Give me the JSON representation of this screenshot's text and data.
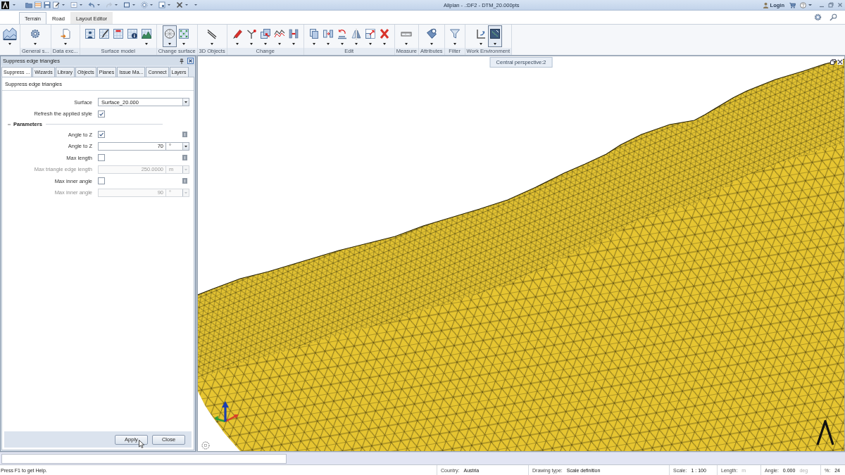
{
  "title_bar": {
    "title": "Allplan - .:DF2 - DTM_20.000pts",
    "login": "Login"
  },
  "ribbon": {
    "tabs": [
      {
        "label": "Terrain",
        "selected": true,
        "kind": "standard"
      },
      {
        "label": "Road",
        "selected": false,
        "kind": "standard"
      },
      {
        "label": "Layout Editor",
        "selected": false,
        "kind": "contextual"
      }
    ],
    "groups": [
      {
        "tools": [
          {
            "kind": "terrain",
            "selected": false,
            "dropdown": true
          }
        ]
      },
      {
        "label": "General s...",
        "tools": [
          {
            "kind": "gear",
            "selected": false,
            "dropdown": true
          }
        ]
      },
      {
        "label": "Data exc...",
        "tools": [
          {
            "kind": "document",
            "selected": false,
            "dropdown": true
          }
        ]
      },
      {
        "label": "Surface model",
        "tools": [
          {
            "kind": "surveyor",
            "selected": false,
            "dropdown": false
          },
          {
            "kind": "brush",
            "selected": false,
            "dropdown": false
          },
          {
            "kind": "marker",
            "selected": false,
            "dropdown": false
          },
          {
            "kind": "info",
            "selected": false,
            "dropdown": false
          },
          {
            "kind": "hills",
            "selected": false,
            "dropdown": true
          }
        ]
      },
      {
        "label": "Change surface",
        "tools": [
          {
            "kind": "mesh",
            "selected": true,
            "dropdown": true
          },
          {
            "kind": "points",
            "selected": false,
            "dropdown": true
          }
        ]
      },
      {
        "label": "3D Objects",
        "tools": [
          {
            "kind": "lines",
            "selected": false,
            "dropdown": true
          }
        ]
      },
      {
        "label": "Change",
        "tools": [
          {
            "kind": "pencil",
            "selected": false,
            "dropdown": true
          },
          {
            "kind": "branch",
            "selected": false,
            "dropdown": true
          },
          {
            "kind": "squares",
            "selected": false,
            "dropdown": true
          },
          {
            "kind": "polyline",
            "selected": false,
            "dropdown": true
          },
          {
            "kind": "beam",
            "selected": false,
            "dropdown": true
          }
        ]
      },
      {
        "label": "Edit",
        "tools": [
          {
            "kind": "copy",
            "selected": false,
            "dropdown": true
          },
          {
            "kind": "move",
            "selected": false,
            "dropdown": true
          },
          {
            "kind": "rotate",
            "selected": false,
            "dropdown": true
          },
          {
            "kind": "mirror",
            "selected": false,
            "dropdown": true
          },
          {
            "kind": "scale",
            "selected": false,
            "dropdown": true
          },
          {
            "kind": "delete",
            "selected": false,
            "dropdown": true
          }
        ]
      },
      {
        "label": "Measure",
        "tools": [
          {
            "kind": "ruler",
            "selected": false,
            "dropdown": true
          }
        ]
      },
      {
        "label": "Attributes",
        "tools": [
          {
            "kind": "tag",
            "selected": false,
            "dropdown": true
          }
        ]
      },
      {
        "label": "Filter",
        "tools": [
          {
            "kind": "funnel",
            "selected": false,
            "dropdown": true
          }
        ]
      },
      {
        "label": "Work Environment",
        "tools": [
          {
            "kind": "axes",
            "selected": false,
            "dropdown": true
          },
          {
            "kind": "screen",
            "selected": true,
            "dropdown": true
          }
        ]
      }
    ]
  },
  "panel": {
    "title": "Suppress edge triangles",
    "tabs": [
      {
        "label": "Suppress ...",
        "selected": true
      },
      {
        "label": "Wizards",
        "selected": false
      },
      {
        "label": "Library",
        "selected": false
      },
      {
        "label": "Objects",
        "selected": false
      },
      {
        "label": "Planes",
        "selected": false
      },
      {
        "label": "Issue Ma...",
        "selected": false
      },
      {
        "label": "Connect",
        "selected": false
      },
      {
        "label": "Layers",
        "selected": false
      }
    ],
    "heading": "Suppress edge triangles",
    "rows": [
      {
        "kind": "combo",
        "label": "Surface",
        "value": "Surface_20.000"
      },
      {
        "kind": "checkbox",
        "label": "Refresh the applied style",
        "checked": true,
        "info": false
      },
      {
        "kind": "section",
        "label": "Parameters",
        "expanded": true
      },
      {
        "kind": "checkbox",
        "label": "Angle to Z",
        "checked": true,
        "info": true
      },
      {
        "kind": "number",
        "label": "Angle to Z",
        "value": "70",
        "unit": "°",
        "disabled": false
      },
      {
        "kind": "checkbox",
        "label": "Max length",
        "checked": false,
        "info": true
      },
      {
        "kind": "number",
        "label": "Max triangle edge length",
        "value": "250.0000",
        "unit": "m",
        "disabled": true
      },
      {
        "kind": "checkbox",
        "label": "Max inner angle",
        "checked": false,
        "info": true
      },
      {
        "kind": "number",
        "label": "Max inner angle",
        "value": "90",
        "unit": "°",
        "disabled": true
      }
    ],
    "buttons": [
      {
        "label": "Apply"
      },
      {
        "label": "Close"
      }
    ]
  },
  "viewport": {
    "label": "Central perspective:2"
  },
  "status_bar": {
    "help": "Press F1 to get Help.",
    "fields": [
      {
        "label": "Country:",
        "value": "Austria"
      },
      {
        "label": "Drawing type:",
        "value": "Scale definition"
      },
      {
        "label": "Scale:",
        "value": "1 : 100"
      },
      {
        "label": "Length:",
        "unit": "m"
      },
      {
        "label": "Angle:",
        "value": "0.000",
        "unit": "deg"
      },
      {
        "label": "%:",
        "value": "24"
      }
    ]
  }
}
